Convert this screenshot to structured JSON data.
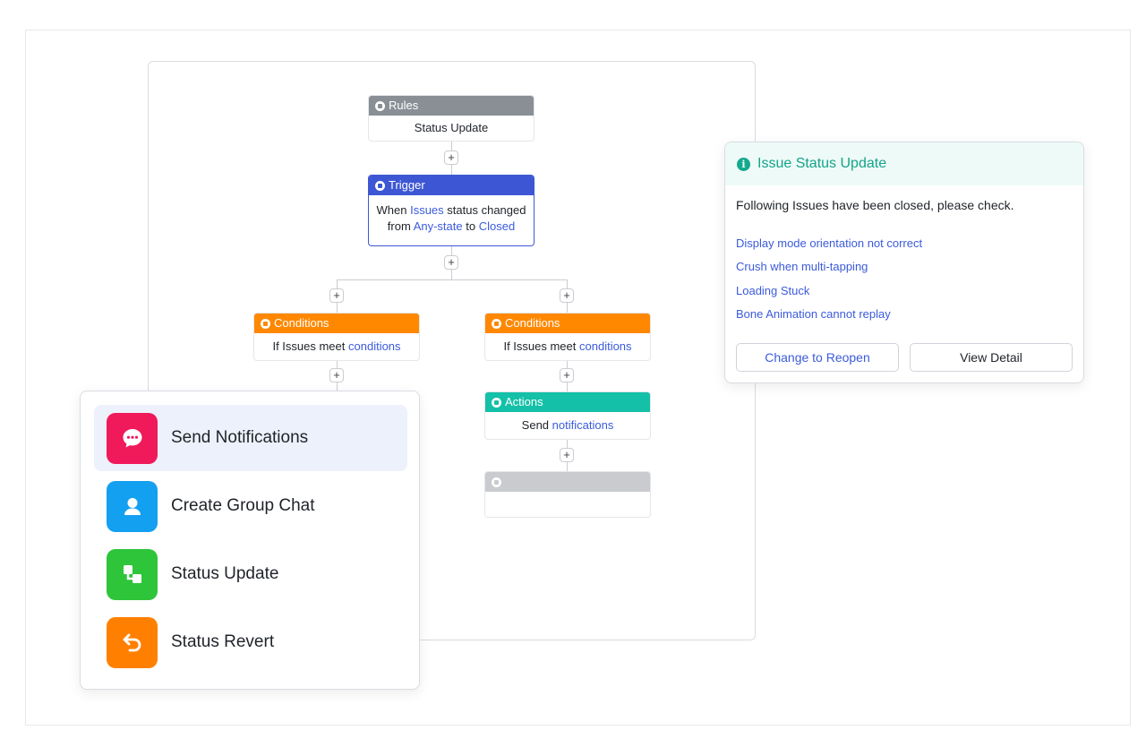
{
  "workflow": {
    "rules": {
      "header": "Rules",
      "body": "Status Update"
    },
    "trigger": {
      "header": "Trigger",
      "line1_prefix": "When",
      "line1_link": "Issues",
      "line1_suffix": "status changed",
      "line2_prefix": "from",
      "line2_link1": "Any-state",
      "line2_mid": "to",
      "line2_link2": "Closed"
    },
    "conditions_left": {
      "header": "Conditions",
      "body_prefix": "If Issues meet",
      "body_link": "conditions"
    },
    "conditions_right": {
      "header": "Conditions",
      "body_prefix": "If Issues meet",
      "body_link": "conditions"
    },
    "actions": {
      "header": "Actions",
      "body_prefix": "Send",
      "body_link": "notifications"
    },
    "plus_symbol": "+"
  },
  "action_menu": {
    "items": [
      {
        "label": "Send Notifications",
        "icon": "chat-bubble-icon",
        "color": "#f0195a",
        "active": true
      },
      {
        "label": "Create Group Chat",
        "icon": "user-icon",
        "color": "#14a0f0",
        "active": false
      },
      {
        "label": "Status Update",
        "icon": "status-flow-icon",
        "color": "#2ec53a",
        "active": false
      },
      {
        "label": "Status Revert",
        "icon": "undo-icon",
        "color": "#ff8000",
        "active": false
      }
    ]
  },
  "notification": {
    "title": "Issue Status Update",
    "message": "Following Issues have been closed, please check.",
    "issues": [
      "Display mode orientation not correct",
      "Crush when multi-tapping",
      "Loading Stuck",
      "Bone Animation cannot replay"
    ],
    "primary_button": "Change to Reopen",
    "secondary_button": "View Detail"
  },
  "colors": {
    "rules": "#8a8f96",
    "trigger": "#3d57d4",
    "conditions": "#ff8800",
    "actions": "#14c0a8",
    "link": "#3b5bdb",
    "notification_accent": "#14a38a"
  }
}
